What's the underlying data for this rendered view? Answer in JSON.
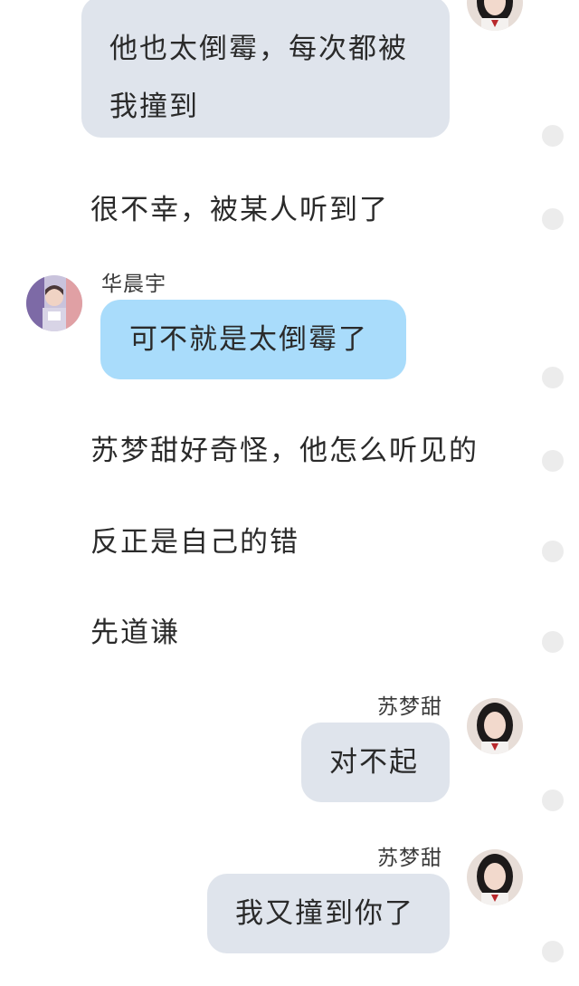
{
  "messages": {
    "m1": {
      "line1": "他也太倒霉，每次都被",
      "line2": "我撞到"
    },
    "n1": "很不幸，被某人听到了",
    "m2": {
      "sender": "华晨宇",
      "text": "可不就是太倒霉了"
    },
    "n2": "苏梦甜好奇怪，他怎么听见的",
    "n3": "反正是自己的错",
    "n4": "先道谦",
    "m3": {
      "sender": "苏梦甜",
      "text": "对不起"
    },
    "m4": {
      "sender": "苏梦甜",
      "text": "我又撞到你了"
    }
  },
  "colors": {
    "bubble_self": "#dfe4ec",
    "bubble_other": "#a9dcfb",
    "select_dot": "#ececec"
  },
  "icons": {
    "avatar_female": "female-avatar-icon",
    "avatar_male": "male-avatar-icon",
    "select_dot": "select-circle-icon"
  }
}
